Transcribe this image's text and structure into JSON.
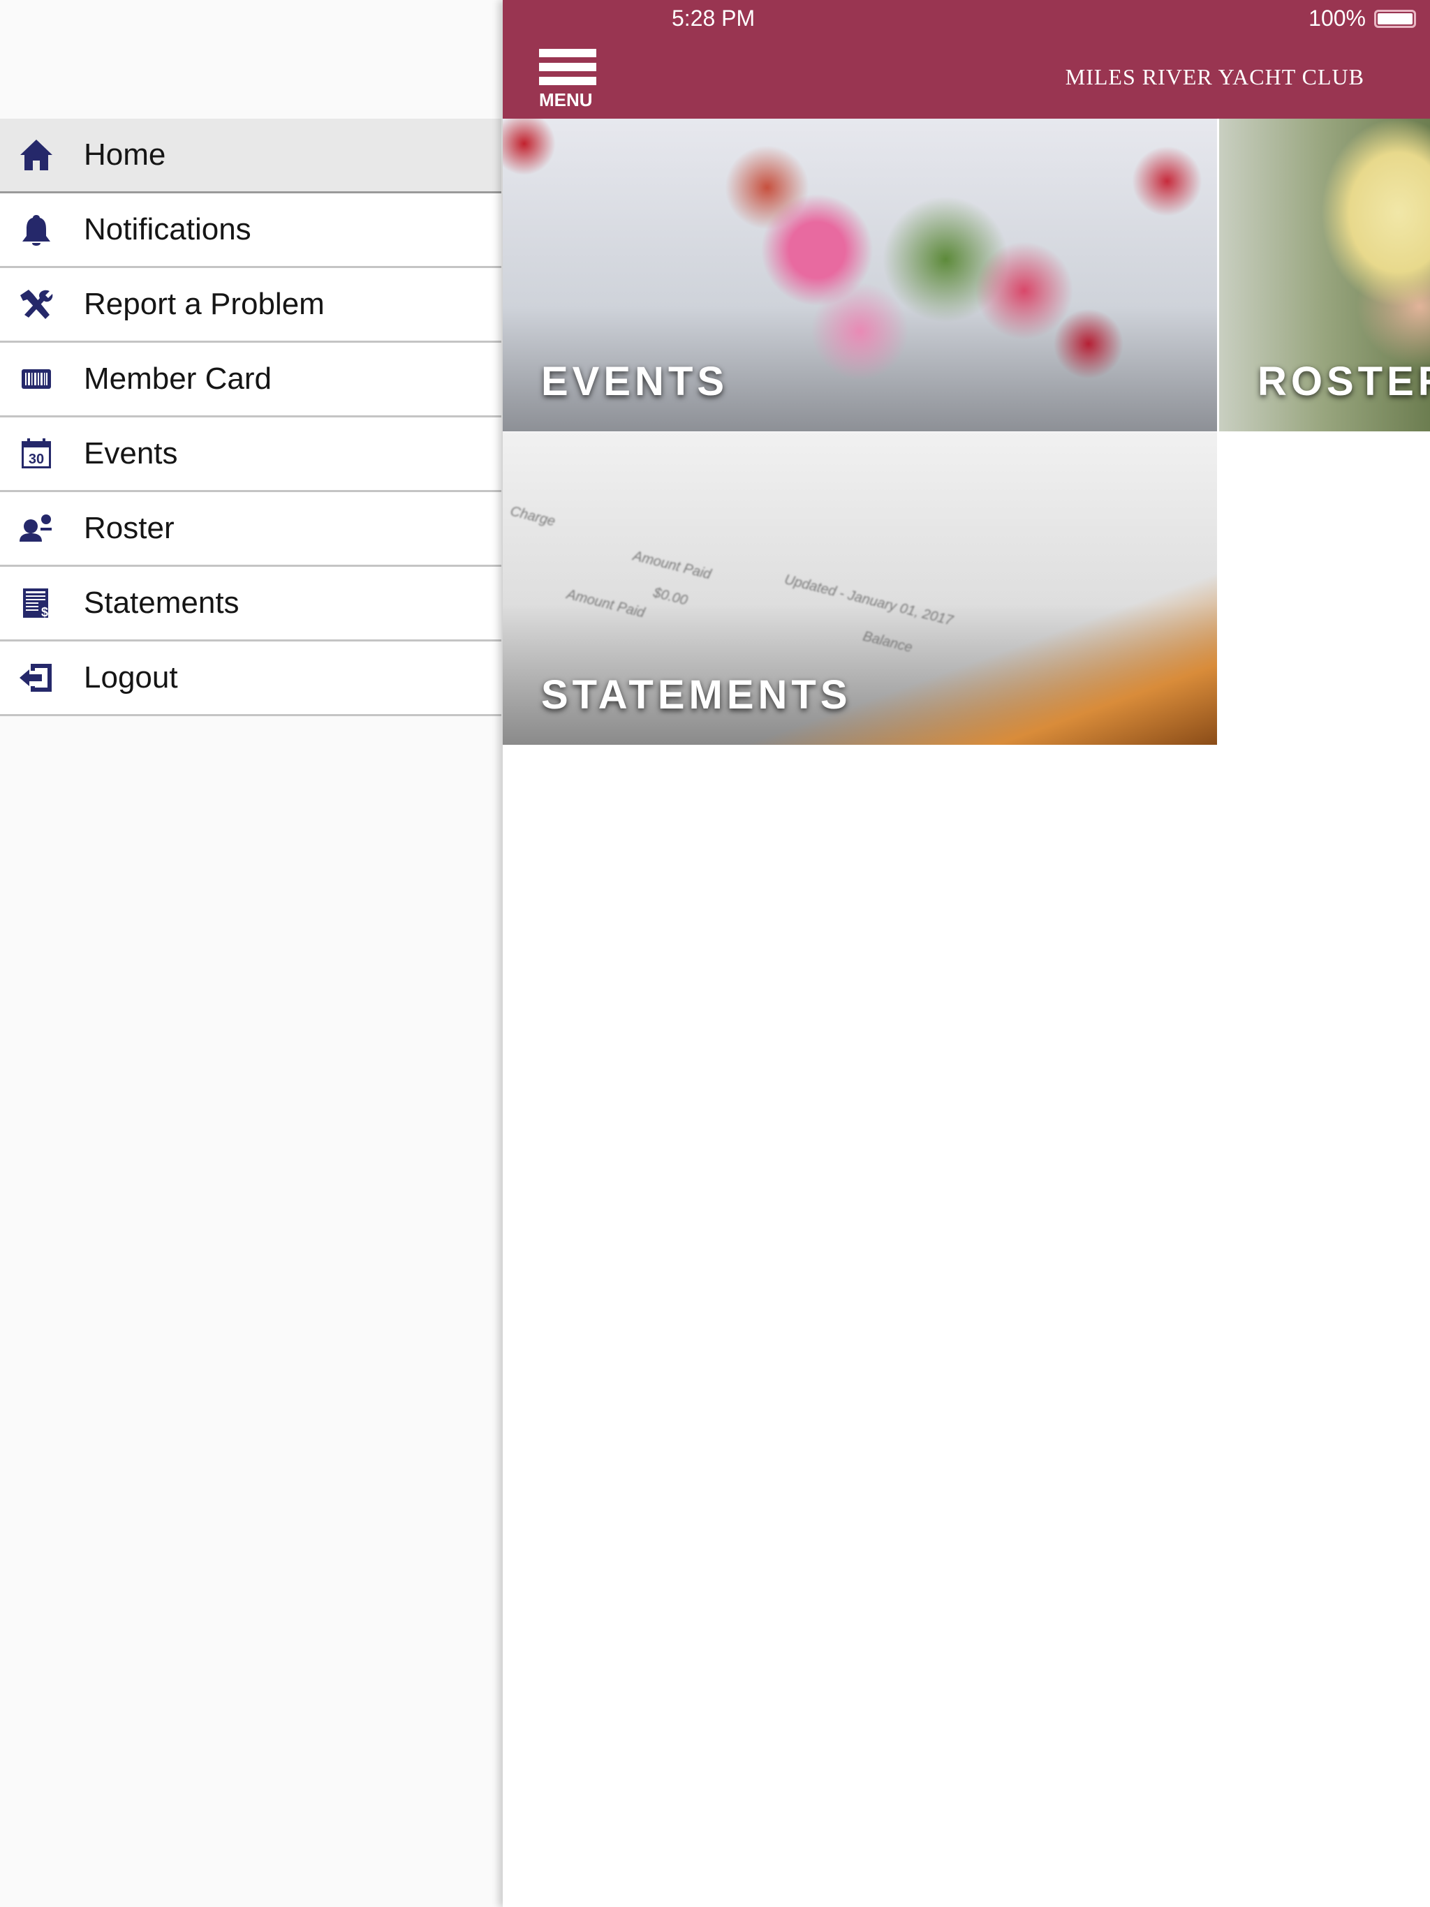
{
  "status_bar": {
    "time": "5:28 PM",
    "battery": "100%",
    "battery_level": 1.0
  },
  "header": {
    "menu_label": "MENU",
    "title": "MILES RIVER YACHT CLUB",
    "color": "#993551"
  },
  "sidebar": {
    "items": [
      {
        "label": "Home",
        "icon": "home-icon",
        "active": true
      },
      {
        "label": "Notifications",
        "icon": "bell-icon"
      },
      {
        "label": "Report a Problem",
        "icon": "tools-icon"
      },
      {
        "label": "Member Card",
        "icon": "barcode-icon"
      },
      {
        "label": "Events",
        "icon": "calendar-icon"
      },
      {
        "label": "Roster",
        "icon": "people-icon"
      },
      {
        "label": "Statements",
        "icon": "statement-icon"
      },
      {
        "label": "Logout",
        "icon": "logout-icon"
      }
    ],
    "icon_color": "#25286a",
    "calendar_day": "30"
  },
  "tiles": [
    {
      "label": "EVENTS"
    },
    {
      "label": "ROSTER"
    },
    {
      "label": "STATEMENTS",
      "image_text": [
        "Charge",
        "Amount Paid",
        "$0.00",
        "Updated - January 01, 2017",
        "Amount Paid",
        "Balance"
      ]
    }
  ]
}
